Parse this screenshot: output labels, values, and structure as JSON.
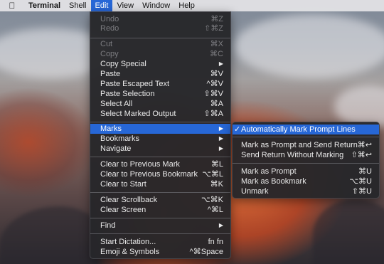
{
  "menubar": {
    "apple_icon": "apple-logo-icon",
    "items": [
      "Terminal",
      "Shell",
      "Edit",
      "View",
      "Window",
      "Help"
    ]
  },
  "edit_menu": {
    "undo": {
      "label": "Undo",
      "shortcut": "⌘Z"
    },
    "redo": {
      "label": "Redo",
      "shortcut": "⇧⌘Z"
    },
    "cut": {
      "label": "Cut",
      "shortcut": "⌘X"
    },
    "copy": {
      "label": "Copy",
      "shortcut": "⌘C"
    },
    "copy_special": {
      "label": "Copy Special"
    },
    "paste": {
      "label": "Paste",
      "shortcut": "⌘V"
    },
    "paste_escaped": {
      "label": "Paste Escaped Text",
      "shortcut": "^⌘V"
    },
    "paste_selection": {
      "label": "Paste Selection",
      "shortcut": "⇧⌘V"
    },
    "select_all": {
      "label": "Select All",
      "shortcut": "⌘A"
    },
    "select_marked": {
      "label": "Select Marked Output",
      "shortcut": "⇧⌘A"
    },
    "marks": {
      "label": "Marks"
    },
    "bookmarks": {
      "label": "Bookmarks"
    },
    "navigate": {
      "label": "Navigate"
    },
    "clear_prev_mark": {
      "label": "Clear to Previous Mark",
      "shortcut": "⌘L"
    },
    "clear_prev_bookmark": {
      "label": "Clear to Previous Bookmark",
      "shortcut": "⌥⌘L"
    },
    "clear_start": {
      "label": "Clear to Start",
      "shortcut": "⌘K"
    },
    "clear_scrollback": {
      "label": "Clear Scrollback",
      "shortcut": "⌥⌘K"
    },
    "clear_screen": {
      "label": "Clear Screen",
      "shortcut": "^⌘L"
    },
    "find": {
      "label": "Find"
    },
    "start_dictation": {
      "label": "Start Dictation...",
      "shortcut": "fn fn"
    },
    "emoji_symbols": {
      "label": "Emoji & Symbols",
      "shortcut": "^⌘Space"
    }
  },
  "marks_menu": {
    "auto_mark": {
      "check": "✓",
      "label": "Automatically Mark Prompt Lines"
    },
    "mark_prompt_send": {
      "label": "Mark as Prompt and Send Return",
      "shortcut": "⌘↩"
    },
    "send_no_mark": {
      "label": "Send Return Without Marking",
      "shortcut": "⇧⌘↩"
    },
    "mark_prompt": {
      "label": "Mark as Prompt",
      "shortcut": "⌘U"
    },
    "mark_bookmark": {
      "label": "Mark as Bookmark",
      "shortcut": "⌥⌘U"
    },
    "unmark": {
      "label": "Unmark",
      "shortcut": "⇧⌘U"
    }
  },
  "colors": {
    "highlight": "#2767d6",
    "menu_bg": "#26262a",
    "menubar_bg": "#e1e1e4"
  }
}
